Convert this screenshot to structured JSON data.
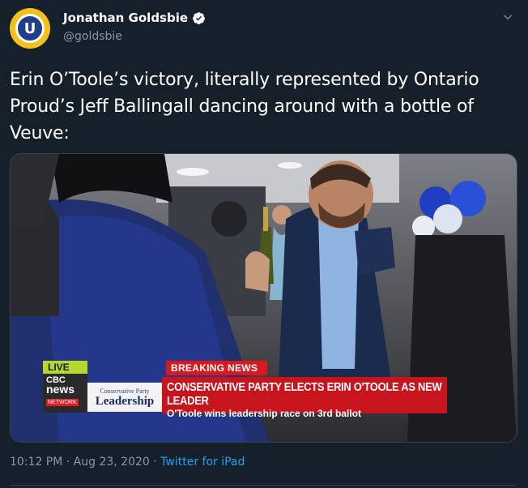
{
  "author": {
    "avatar_letter": "U",
    "display_name": "Jonathan Goldsbie",
    "handle": "@goldsbie",
    "verified": true
  },
  "tweet": {
    "text": "Erin O’Toole’s victory, literally represented by Ontario Proud’s Jeff Ballingall dancing around with a bottle of Veuve:"
  },
  "media_overlay": {
    "live_label": "LIVE",
    "cbc_top": "CBC",
    "cbc_news": "news",
    "cbc_network": "NETWORK",
    "program_sub": "Conservative Party",
    "program_main": "Leadership",
    "breaking_label": "BREAKING NEWS",
    "headline": "CONSERVATIVE PARTY ELECTS ERIN O'TOOLE AS NEW LEADER",
    "subheadline": "O'Toole wins leadership race on 3rd ballot"
  },
  "meta": {
    "timestamp": "10:12 PM · Aug 23, 2020 · ",
    "source": "Twitter for iPad"
  },
  "colors": {
    "background": "#15202b",
    "secondary_text": "#8899a6",
    "link": "#1da1f2",
    "cbc_red": "#d71920",
    "live_green": "#b5d82f"
  }
}
